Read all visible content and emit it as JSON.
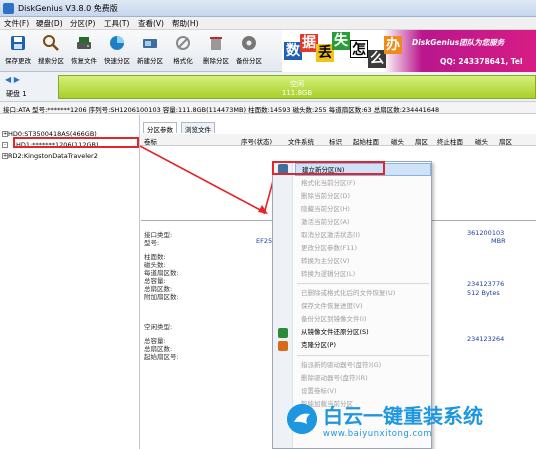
{
  "window": {
    "title": "DiskGenius V3.8.0 免费版"
  },
  "menu": [
    "文件(F)",
    "硬盘(D)",
    "分区(P)",
    "工具(T)",
    "查看(V)",
    "帮助(H)"
  ],
  "toolbar": [
    {
      "label": "保存更改",
      "icon": "save-icon",
      "color": "#1f5fb5"
    },
    {
      "label": "搜索分区",
      "icon": "search-icon",
      "color": "#7a4a12"
    },
    {
      "label": "恢复文件",
      "icon": "recover-icon",
      "color": "#2a6a2a"
    },
    {
      "label": "快速分区",
      "icon": "quick-partition-icon",
      "color": "#1f7fc5"
    },
    {
      "label": "新建分区",
      "icon": "new-partition-icon",
      "color": "#3d6e9c"
    },
    {
      "label": "格式化",
      "icon": "format-icon",
      "color": "#8a8a8a"
    },
    {
      "label": "删除分区",
      "icon": "delete-icon",
      "color": "#c12a2a"
    },
    {
      "label": "备份分区",
      "icon": "backup-icon",
      "color": "#555555"
    }
  ],
  "banner": {
    "chars": [
      "数",
      "据",
      "丢",
      "失",
      "怎",
      "么",
      "办"
    ],
    "brand": "DiskGenius团队为您服务",
    "qq": "QQ: 243378641, Tel"
  },
  "diskbar": {
    "disk_label": "硬盘 1",
    "partition_name": "空闲",
    "partition_size": "111.8GB"
  },
  "infobar": "接口:ATA  型号:*******1206  序列号:SH1206100103  容量:111.8GB(114473MB)  柱面数:14593  磁头数:255  每道扇区数:63  总扇区数:234441648",
  "tree": {
    "disks": [
      {
        "label": "HD0:ST3500418AS(466GB)"
      },
      {
        "label": "HD1:*******1206(112GB)"
      },
      {
        "label": "RD2:KingstonDataTraveler2"
      }
    ]
  },
  "tabs": [
    "分区参数",
    "浏览文件"
  ],
  "columns": [
    "卷标",
    "序号(状态)",
    "文件系统",
    "标识",
    "起始柱面",
    "磁头",
    "扇区",
    "终止柱面",
    "磁头",
    "扇区"
  ],
  "details": {
    "labels": [
      "接口类型:",
      "型号:",
      "柱面数:",
      "磁头数:",
      "每道扇区数:",
      "总容量:",
      "总扇区数:",
      "附加扇区数:",
      "空闲类型:",
      "总容量:",
      "总扇区数:",
      "起始扇区号:"
    ],
    "values": [
      "EF250",
      "361200103",
      "MBR",
      "234123776",
      "512 Bytes",
      "234123264"
    ]
  },
  "context_menu": [
    {
      "label": "建立新分区(N)",
      "enabled": true,
      "selected": true,
      "icon": "new-partition-icon"
    },
    {
      "label": "格式化当前分区(F)",
      "enabled": false
    },
    {
      "label": "删除当前分区(D)",
      "enabled": false
    },
    {
      "label": "隐藏当前分区(H)",
      "enabled": false
    },
    {
      "label": "激活当前分区(A)",
      "enabled": false
    },
    {
      "label": "取消分区激活状态(I)",
      "enabled": false
    },
    {
      "label": "更改分区参数(F11)",
      "enabled": false
    },
    {
      "label": "转换为主分区(V)",
      "enabled": false
    },
    {
      "label": "转换为逻辑分区(L)",
      "enabled": false
    },
    {
      "sep": true
    },
    {
      "label": "已删除或格式化后的文件恢复(U)",
      "enabled": false
    },
    {
      "label": "保存文件恢复进度(V)",
      "enabled": false
    },
    {
      "label": "备份分区到镜像文件(I)",
      "enabled": false
    },
    {
      "label": "从镜像文件还原分区(S)",
      "enabled": true,
      "icon": "restore-icon"
    },
    {
      "label": "克隆分区(P)",
      "enabled": true,
      "icon": "clone-icon"
    },
    {
      "sep": true
    },
    {
      "label": "指派新的驱动器号(盘符)(G)",
      "enabled": false
    },
    {
      "label": "删除驱动器号(盘符)(R)",
      "enabled": false
    },
    {
      "label": "设置卷标(V)",
      "enabled": false
    },
    {
      "label": "智能加载当前分区",
      "enabled": false
    }
  ],
  "watermark": {
    "text": "白云一键重装系统",
    "url": "www.baiyunxitong.com"
  }
}
